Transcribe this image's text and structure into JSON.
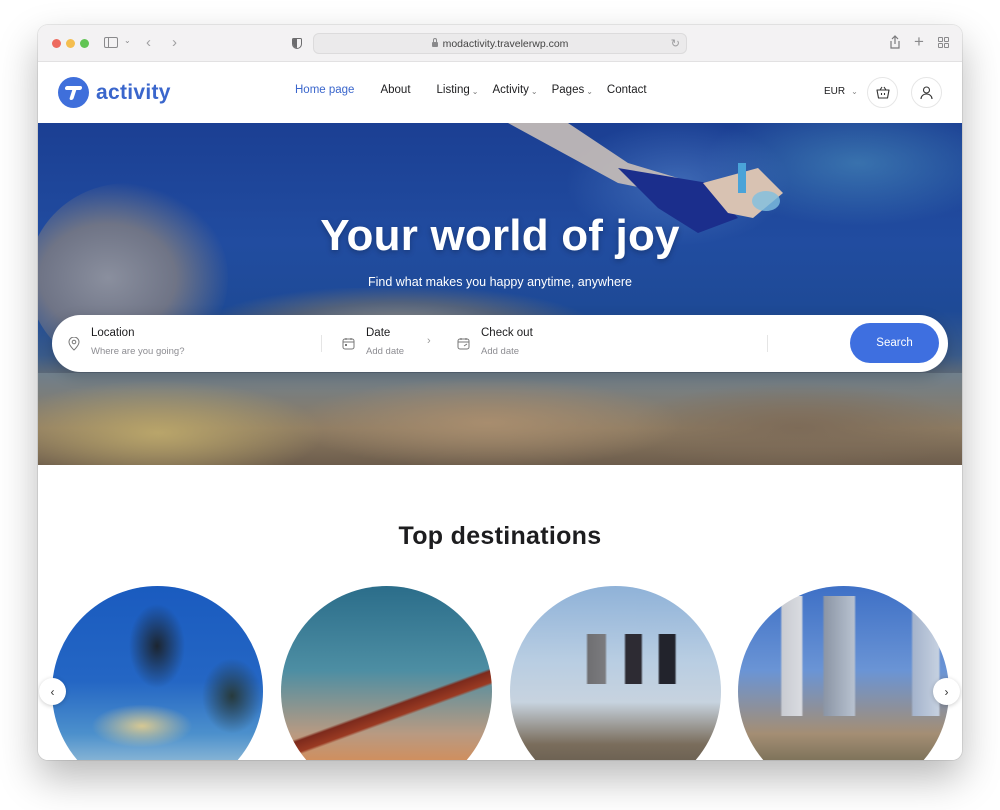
{
  "browser": {
    "url": "modactivity.travelerwp.com"
  },
  "site": {
    "brand": "activity",
    "brand_color": "#3a66cc",
    "nav": [
      {
        "label": "Home page",
        "active": true,
        "has_dropdown": false
      },
      {
        "label": "About",
        "active": false,
        "has_dropdown": false
      },
      {
        "label": "Listing",
        "active": false,
        "has_dropdown": true
      },
      {
        "label": "Activity",
        "active": false,
        "has_dropdown": true
      },
      {
        "label": "Pages",
        "active": false,
        "has_dropdown": true
      },
      {
        "label": "Contact",
        "active": false,
        "has_dropdown": false
      }
    ],
    "currency": "EUR"
  },
  "hero": {
    "title": "Your world of joy",
    "subtitle": "Find what makes you happy anytime, anywhere",
    "search": {
      "location_label": "Location",
      "location_placeholder": "Where are you going?",
      "date_label": "Date",
      "date_placeholder": "Add date",
      "checkout_label": "Check out",
      "checkout_placeholder": "Add date",
      "button_label": "Search",
      "button_color": "#3e6fe0"
    }
  },
  "destinations": {
    "title": "Top destinations",
    "items": [
      {
        "image": "scuba-diver-stingray"
      },
      {
        "image": "bay-bridge-sunset"
      },
      {
        "image": "city-skyline-daytime"
      },
      {
        "image": "downtown-skyscrapers-palms"
      }
    ]
  }
}
